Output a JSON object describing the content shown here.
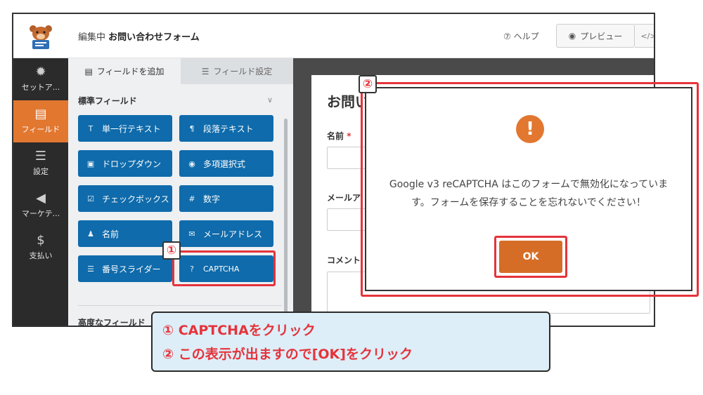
{
  "header": {
    "editing_prefix": "編集中",
    "form_name": "お問い合わせフォーム",
    "help_label": "ヘルプ",
    "preview_label": "プレビュー",
    "code_label": "</>"
  },
  "nav": {
    "items": [
      {
        "label": "セットア...",
        "icon": "gear-icon"
      },
      {
        "label": "フィールド",
        "icon": "fields-icon",
        "active": true
      },
      {
        "label": "設定",
        "icon": "sliders-icon"
      },
      {
        "label": "マーケテ...",
        "icon": "megaphone-icon"
      },
      {
        "label": "支払い",
        "icon": "dollar-icon"
      }
    ]
  },
  "panel": {
    "tab_add_fields": "フィールドを追加",
    "tab_field_settings": "フィールド設定",
    "standard_fields_title": "標準フィールド",
    "advanced_fields_title": "高度なフィールド",
    "fields": [
      {
        "label": "単一行テキスト",
        "icon": "text-line-icon"
      },
      {
        "label": "段落テキスト",
        "icon": "paragraph-icon"
      },
      {
        "label": "ドロップダウン",
        "icon": "dropdown-icon"
      },
      {
        "label": "多項選択式",
        "icon": "radio-icon"
      },
      {
        "label": "チェックボックス",
        "icon": "checkbox-icon"
      },
      {
        "label": "数字",
        "icon": "hash-icon"
      },
      {
        "label": "名前",
        "icon": "user-icon"
      },
      {
        "label": "メールアドレス",
        "icon": "envelope-icon"
      },
      {
        "label": "番号スライダー",
        "icon": "slider-icon"
      },
      {
        "label": "CAPTCHA",
        "icon": "question-icon"
      }
    ]
  },
  "form_preview": {
    "title": "お問い",
    "name_label": "名前",
    "required_mark": "*",
    "email_label": "メールア",
    "comment_label": "コメント"
  },
  "modal": {
    "icon": "warning-icon",
    "message": "Google v3 reCAPTCHA はこのフォームで無効化になっています。フォームを保存することを忘れないでください！",
    "ok_label": "OK"
  },
  "badges": {
    "one": "①",
    "two": "②"
  },
  "callout": {
    "line1": "① CAPTCHAをクリック",
    "line2": "② この表示が出ますので[OK]をクリック"
  },
  "colors": {
    "accent_orange": "#e27730",
    "field_button_blue": "#0f6bab",
    "highlight_red": "#e5333b",
    "nav_dark": "#2b2b2b",
    "callout_bg": "#ddeef8"
  }
}
